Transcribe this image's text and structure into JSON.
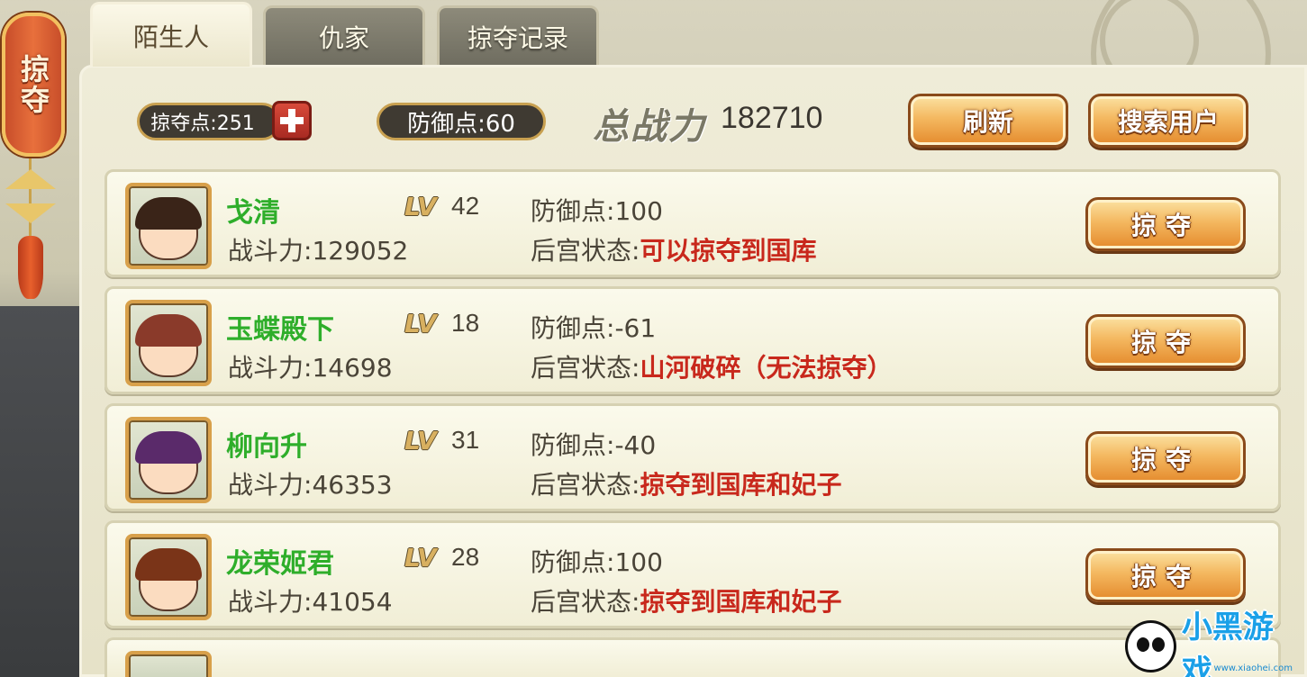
{
  "side_banner": {
    "label": "掠夺"
  },
  "tabs": [
    {
      "label": "陌生人",
      "active": true
    },
    {
      "label": "仇家",
      "active": false
    },
    {
      "label": "掠夺记录",
      "active": false
    }
  ],
  "stats": {
    "rob_points": "掠夺点:251",
    "defense_points": "防御点:60",
    "total_power_label": "总战力",
    "total_power_value": "182710"
  },
  "buttons": {
    "refresh": "刷新",
    "search_user": "搜索用户"
  },
  "labels": {
    "lv": "LV",
    "combat_prefix": "战斗力:",
    "defense_prefix": "防御点:",
    "status_prefix": "后宫状态:",
    "rob_button": "掠夺"
  },
  "players": [
    {
      "name": "戈清",
      "level": "42",
      "combat": "129052",
      "defense": "100",
      "status": "可以掠夺到国库",
      "hair_color": "#3a2418",
      "accent": "#e03040"
    },
    {
      "name": "玉蝶殿下",
      "level": "18",
      "combat": "14698",
      "defense": "-61",
      "status": "山河破碎（无法掠夺）",
      "hair_color": "#8a3a2a",
      "accent": "#f0c020"
    },
    {
      "name": "柳向升",
      "level": "31",
      "combat": "46353",
      "defense": "-40",
      "status": "掠夺到国库和妃子",
      "hair_color": "#5a2a6a",
      "accent": "#c03a8a"
    },
    {
      "name": "龙荣姬君",
      "level": "28",
      "combat": "41054",
      "defense": "100",
      "status": "掠夺到国库和妃子",
      "hair_color": "#7a3418",
      "accent": "#d04030"
    }
  ],
  "watermark": {
    "text": "小黑游戏",
    "url": "www.xiaohei.com"
  },
  "colors": {
    "name_green": "#2fae2a",
    "status_red": "#c8281c",
    "button_gold": "#f4b860"
  }
}
